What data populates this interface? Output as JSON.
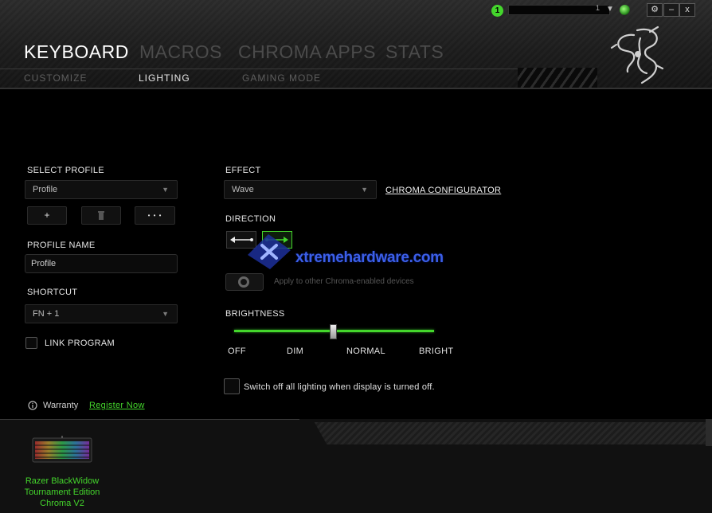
{
  "topbar": {
    "notification_count": "1",
    "user_number": "1",
    "buttons": {
      "settings": "⚙",
      "minimize": "–",
      "close": "x"
    }
  },
  "main_tabs": [
    {
      "label": "KEYBOARD",
      "active": true
    },
    {
      "label": "MACROS",
      "active": false
    },
    {
      "label": "CHROMA APPS",
      "active": false
    },
    {
      "label": "STATS",
      "active": false
    }
  ],
  "sub_tabs": [
    {
      "label": "CUSTOMIZE",
      "active": false
    },
    {
      "label": "LIGHTING",
      "active": true
    },
    {
      "label": "GAMING MODE",
      "active": false
    }
  ],
  "left_panel": {
    "select_profile_label": "SELECT PROFILE",
    "profile_value": "Profile",
    "add_button": "+",
    "delete_icon": "trash-icon",
    "more_button": "• • •",
    "profile_name_label": "PROFILE NAME",
    "profile_name_value": "Profile",
    "shortcut_label": "SHORTCUT",
    "shortcut_value": "FN + 1",
    "link_program_label": "LINK PROGRAM",
    "warranty_label": "Warranty",
    "register_link": "Register Now"
  },
  "lighting": {
    "effect_label": "EFFECT",
    "effect_value": "Wave",
    "configurator_link": "CHROMA CONFIGURATOR",
    "direction_label": "DIRECTION",
    "apply_hint": "Apply to other Chroma-enabled devices",
    "brightness_label": "BRIGHTNESS",
    "brightness_marks": [
      "OFF",
      "DIM",
      "NORMAL",
      "BRIGHT"
    ],
    "brightness_level": 0.5,
    "switch_off_label": "Switch off all lighting when display is turned off."
  },
  "watermark": "xtremehardware.com",
  "device": {
    "name_line1": "Razer BlackWidow",
    "name_line2": "Tournament Edition",
    "name_line3": "Chroma V2"
  },
  "colors": {
    "accent": "#44d62c",
    "watermark": "#3b5fe8"
  }
}
